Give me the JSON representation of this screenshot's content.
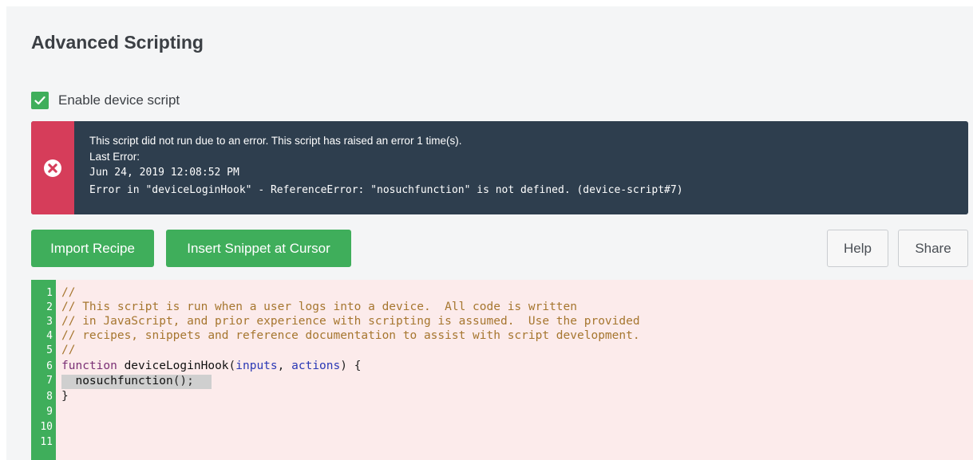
{
  "section": {
    "title": "Advanced Scripting"
  },
  "enable_script": {
    "label": "Enable device script",
    "checked": true
  },
  "alert": {
    "icon": "error-circle-x-icon",
    "message": "This script did not run due to an error. This script has raised an error 1 time(s).",
    "last_error_label": "Last Error:",
    "timestamp": "Jun 24, 2019 12:08:52 PM",
    "error_text": "Error in \"deviceLoginHook\" - ReferenceError: \"nosuchfunction\" is not defined. (device-script#7)"
  },
  "buttons": {
    "import_recipe": "Import Recipe",
    "insert_snippet": "Insert Snippet at Cursor",
    "help": "Help",
    "share": "Share"
  },
  "editor": {
    "line_numbers": [
      "1",
      "2",
      "3",
      "4",
      "5",
      "6",
      "7",
      "8",
      "9",
      "10",
      "11"
    ],
    "lines": {
      "l1": "//",
      "l2": "// This script is run when a user logs into a device.  All code is written",
      "l3": "// in JavaScript, and prior experience with scripting is assumed.  Use the provided",
      "l4": "// recipes, snippets and reference documentation to assist with script development.",
      "l5": "//",
      "l6_kw": "function",
      "l6_name": "deviceLoginHook",
      "l6_p1": "inputs",
      "l6_p2": "actions",
      "l6_open": "(",
      "l6_comma": ", ",
      "l6_close": ") {",
      "l7": "  nosuchfunction",
      "l7_rest": "();",
      "l8": "}"
    }
  },
  "colors": {
    "accent_green": "#3fae5b",
    "alert_dark": "#2e3e4e",
    "alert_red": "#d63d5a",
    "editor_error_bg": "#fcebeb"
  }
}
